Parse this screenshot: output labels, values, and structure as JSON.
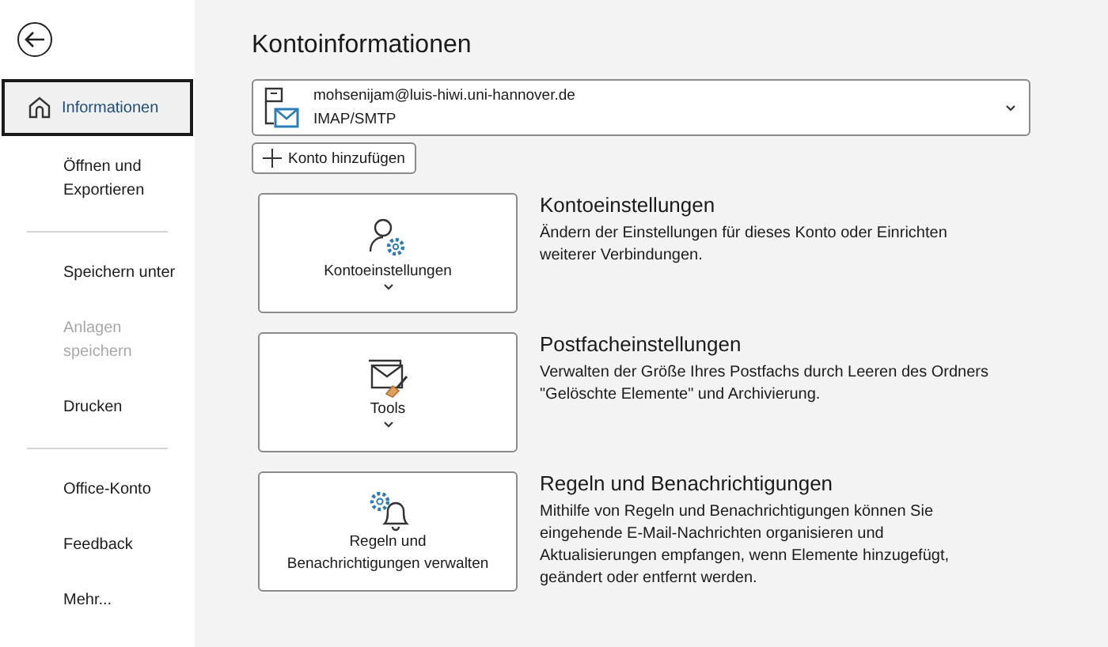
{
  "sidebar": {
    "groups": [
      [
        {
          "label": "Informationen",
          "selected": true,
          "disabled": false,
          "home": true
        },
        {
          "label": "Öffnen und\nExportieren",
          "selected": false,
          "disabled": false
        }
      ],
      [
        {
          "label": "Speichern unter",
          "selected": false,
          "disabled": false
        },
        {
          "label": "Anlagen\nspeichern",
          "selected": false,
          "disabled": true
        },
        {
          "label": "Drucken",
          "selected": false,
          "disabled": false
        }
      ],
      [
        {
          "label": "Office-Konto",
          "selected": false,
          "disabled": false
        },
        {
          "label": "Feedback",
          "selected": false,
          "disabled": false
        },
        {
          "label": "Mehr...",
          "selected": false,
          "disabled": false
        }
      ]
    ]
  },
  "title": "Kontoinformationen",
  "account": {
    "email": "mohsenijam@luis-hiwi.uni-hannover.de",
    "type": "IMAP/SMTP"
  },
  "add_account": "Konto hinzufügen",
  "sections": [
    {
      "kind": "account",
      "button": "Kontoeinstellungen",
      "dropdown": true,
      "heading": "Kontoeinstellungen",
      "text": "Ändern der Einstellungen für dieses Konto oder Einrichten weiterer Verbindungen."
    },
    {
      "kind": "mailbox",
      "button": "Tools",
      "dropdown": true,
      "heading": "Postfacheinstellungen",
      "text": "Verwalten der Größe Ihres Postfachs durch Leeren des Ordners \"Gelöschte Elemente\" und Archivierung."
    },
    {
      "kind": "rules",
      "button": "Regeln und\nBenachrichtigungen verwalten",
      "dropdown": false,
      "heading": "Regeln und Benachrichtigungen",
      "text": "Mithilfe von Regeln und Benachrichtigungen können Sie eingehende E-Mail-Nachrichten organisieren und Aktualisierungen empfangen, wenn Elemente hinzugefügt, geändert oder entfernt werden."
    }
  ]
}
